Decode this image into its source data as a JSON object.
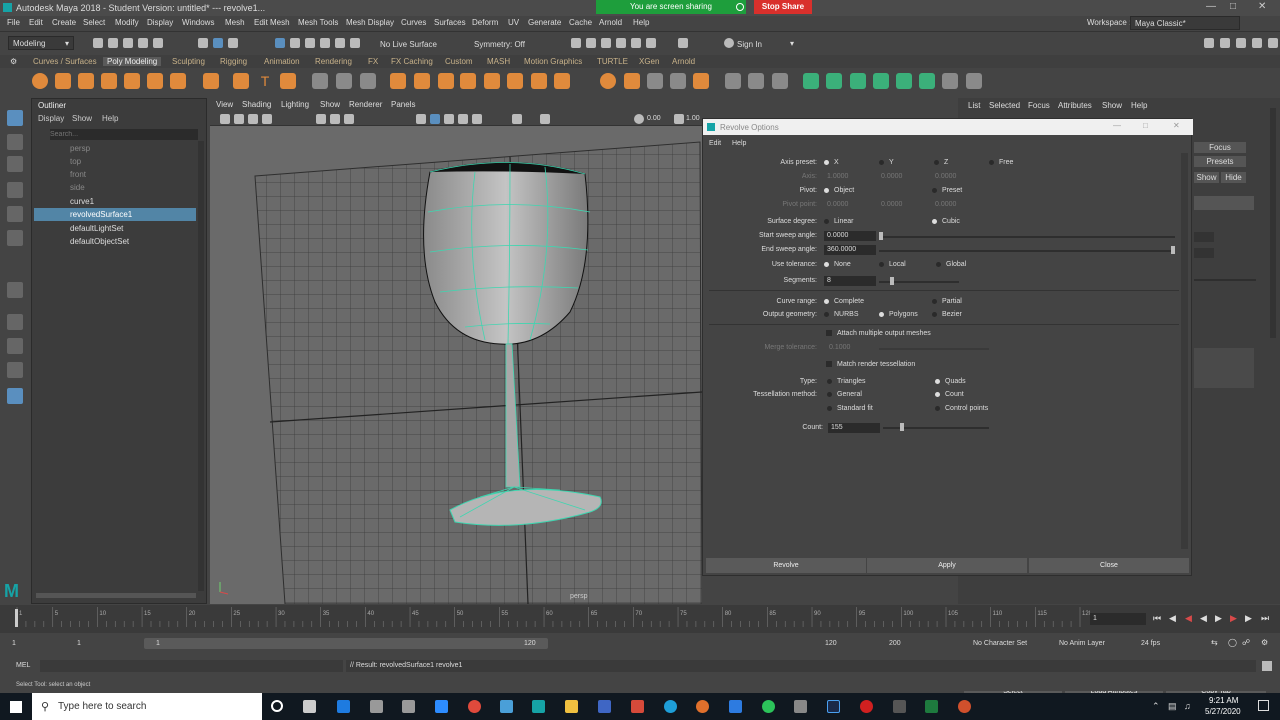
{
  "window": {
    "title": "Autodesk Maya 2018 - Student Version: untitled*   ---   revolve1...",
    "share_text": "You are screen sharing",
    "stop_share": "Stop Share"
  },
  "menubar": [
    "File",
    "Edit",
    "Create",
    "Select",
    "Modify",
    "Display",
    "Windows",
    "Mesh",
    "Edit Mesh",
    "Mesh Tools",
    "Mesh Display",
    "Curves",
    "Surfaces",
    "Deform",
    "UV",
    "Generate",
    "Cache",
    "Arnold",
    "Help"
  ],
  "workspace": {
    "label": "Workspace :",
    "value": "Maya Classic*"
  },
  "statusline": {
    "mode": "Modeling",
    "live_surface": "No Live Surface",
    "symmetry": "Symmetry: Off",
    "sign_in": "Sign In"
  },
  "shelf_tabs": [
    "Curves / Surfaces",
    "Poly Modeling",
    "Sculpting",
    "Rigging",
    "Animation",
    "Rendering",
    "FX",
    "FX Caching",
    "Custom",
    "MASH",
    "Motion Graphics",
    "TURTLE",
    "XGen",
    "Arnold"
  ],
  "shelf_active": "Poly Modeling",
  "outliner": {
    "title": "Outliner",
    "menu": [
      "Display",
      "Show",
      "Help"
    ],
    "search_placeholder": "Search...",
    "items": [
      {
        "label": "persp",
        "state": "dim"
      },
      {
        "label": "top",
        "state": "dim"
      },
      {
        "label": "front",
        "state": "dim"
      },
      {
        "label": "side",
        "state": "dim"
      },
      {
        "label": "curve1",
        "state": "normal"
      },
      {
        "label": "revolvedSurface1",
        "state": "selected"
      },
      {
        "label": "defaultLightSet",
        "state": "normal"
      },
      {
        "label": "defaultObjectSet",
        "state": "normal"
      }
    ]
  },
  "viewport": {
    "menu": [
      "View",
      "Shading",
      "Lighting",
      "Show",
      "Renderer",
      "Panels"
    ],
    "field1": "0.00",
    "field2": "1.00",
    "camera_label": "persp"
  },
  "dialog": {
    "title": "Revolve Options",
    "menu": [
      "Edit",
      "Help"
    ],
    "axis_preset": {
      "label": "Axis preset:",
      "options": [
        "X",
        "Y",
        "Z",
        "Free"
      ],
      "selected": "X"
    },
    "axis": {
      "label": "Axis:",
      "values": [
        "1.0000",
        "0.0000",
        "0.0000"
      ]
    },
    "pivot": {
      "label": "Pivot:",
      "options": [
        "Object",
        "Preset"
      ],
      "selected": "Object"
    },
    "pivot_point": {
      "label": "Pivot point:",
      "values": [
        "0.0000",
        "0.0000",
        "0.0000"
      ]
    },
    "surface_degree": {
      "label": "Surface degree:",
      "options": [
        "Linear",
        "Cubic"
      ],
      "selected": "Cubic"
    },
    "start_sweep": {
      "label": "Start sweep angle:",
      "value": "0.0000"
    },
    "end_sweep": {
      "label": "End sweep angle:",
      "value": "360.0000"
    },
    "use_tolerance": {
      "label": "Use tolerance:",
      "options": [
        "None",
        "Local",
        "Global"
      ],
      "selected": "None"
    },
    "segments": {
      "label": "Segments:",
      "value": "8"
    },
    "curve_range": {
      "label": "Curve range:",
      "options": [
        "Complete",
        "Partial"
      ],
      "selected": "Complete"
    },
    "output_geometry": {
      "label": "Output geometry:",
      "options": [
        "NURBS",
        "Polygons",
        "Bezier"
      ],
      "selected": "Polygons"
    },
    "attach_multiple": "Attach multiple output meshes",
    "merge_tolerance": {
      "label": "Merge tolerance:",
      "value": "0.1000"
    },
    "match_render": "Match render tessellation",
    "type": {
      "label": "Type:",
      "options": [
        "Triangles",
        "Quads"
      ],
      "selected": "Quads"
    },
    "tess_method": {
      "label": "Tessellation method:",
      "options": [
        "General",
        "Count",
        "Standard fit",
        "Control points"
      ],
      "selected": "Count"
    },
    "count": {
      "label": "Count:",
      "value": "155"
    },
    "buttons": [
      "Revolve",
      "Apply",
      "Close"
    ]
  },
  "right_panel": {
    "menu": [
      "List",
      "Selected",
      "Focus",
      "Attributes",
      "Show",
      "Help"
    ],
    "focus": "Focus",
    "presets": "Presets",
    "show": "Show",
    "hide": "Hide",
    "buttons": [
      "Select",
      "Load Attributes",
      "Copy Tab"
    ]
  },
  "time": {
    "ticks": [
      "1",
      "5",
      "10",
      "15",
      "20",
      "25",
      "30",
      "35",
      "40",
      "45",
      "50",
      "55",
      "60",
      "65",
      "70",
      "75",
      "80",
      "85",
      "90",
      "95",
      "100",
      "105",
      "110",
      "115",
      "120"
    ],
    "current": "1",
    "range_start": "1",
    "range_start2": "1",
    "range_end_mark": "120",
    "range_end": "120",
    "anim_end": "200",
    "char_set": "No Character Set",
    "anim_layer": "No Anim Layer",
    "fps": "24 fps"
  },
  "command": {
    "lang": "MEL",
    "result": "// Result: revolvedSurface1 revolve1",
    "help": "Select Tool: select an object"
  },
  "taskbar": {
    "search": "Type here to search",
    "time": "9:21 AM",
    "date": "5/27/2020"
  }
}
